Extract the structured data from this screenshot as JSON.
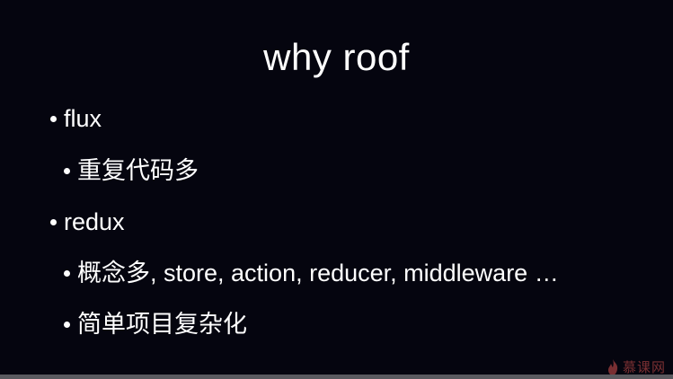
{
  "slide": {
    "title": "why roof",
    "bullets": [
      {
        "text": "flux",
        "level": 1
      },
      {
        "text": "重复代码多",
        "level": 2
      },
      {
        "text": "redux",
        "level": 1
      },
      {
        "text": "概念多, store, action, reducer, middleware …",
        "level": 2
      },
      {
        "text": "简单项目复杂化",
        "level": 2
      }
    ]
  },
  "watermark": {
    "text": "慕课网",
    "icon": "flame-logo-icon",
    "color": "#d9534f"
  },
  "colors": {
    "background": "#05050f",
    "text": "#ffffff"
  }
}
